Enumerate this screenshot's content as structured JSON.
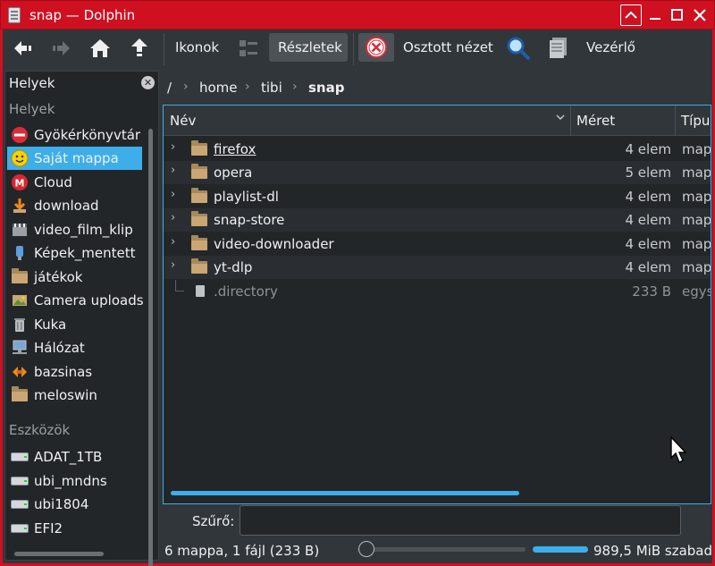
{
  "window": {
    "title": "snap — Dolphin",
    "controls": {
      "keep_above": "^",
      "minimize": "_",
      "maximize": "□",
      "close": "✕"
    }
  },
  "toolbar": {
    "back": "back-arrow-icon",
    "forward": "forward-arrow-icon",
    "home": "home-icon",
    "up": "up-arrow-icon",
    "icons_label": "Ikonok",
    "details_label": "Részletek",
    "split_label": "Osztott nézet",
    "control_label": "Vezérlő"
  },
  "places": {
    "header": "Helyek",
    "section_places": "Helyek",
    "items": [
      {
        "label": "Gyökérkönyvtár",
        "icon": "root-icon"
      },
      {
        "label": "Saját mappa",
        "icon": "home-smiley-icon",
        "selected": true
      },
      {
        "label": "Cloud",
        "icon": "mega-cloud-icon"
      },
      {
        "label": "download",
        "icon": "download-folder-icon"
      },
      {
        "label": "video_film_klip",
        "icon": "video-icon"
      },
      {
        "label": "Képek_mentett",
        "icon": "pictures-icon"
      },
      {
        "label": "játékok",
        "icon": "folder-icon"
      },
      {
        "label": "Camera uploads",
        "icon": "camera-folder-icon"
      },
      {
        "label": "Kuka",
        "icon": "trash-icon"
      },
      {
        "label": "Hálózat",
        "icon": "network-icon"
      },
      {
        "label": "bazsinas",
        "icon": "remote-icon"
      },
      {
        "label": "meloswin",
        "icon": "folder-icon"
      }
    ],
    "section_devices": "Eszközök",
    "devices": [
      {
        "label": "ADAT_1TB"
      },
      {
        "label": "ubi_mndns"
      },
      {
        "label": "ubi1804"
      },
      {
        "label": "EFI2"
      }
    ]
  },
  "breadcrumb": {
    "root": "/",
    "parts": [
      "home",
      "tibi",
      "snap"
    ]
  },
  "columns": {
    "name": "Név",
    "size": "Méret",
    "type": "Típu"
  },
  "files": [
    {
      "name": "firefox",
      "size": "4 elem",
      "type": "map"
    },
    {
      "name": "opera",
      "size": "5 elem",
      "type": "map"
    },
    {
      "name": "playlist-dl",
      "size": "4 elem",
      "type": "map"
    },
    {
      "name": "snap-store",
      "size": "4 elem",
      "type": "map"
    },
    {
      "name": "video-downloader",
      "size": "4 elem",
      "type": "map"
    },
    {
      "name": "yt-dlp",
      "size": "4 elem",
      "type": "map"
    },
    {
      "name": ".directory",
      "size": "233 B",
      "type": "egys"
    }
  ],
  "filter": {
    "label": "Szűrő:",
    "value": ""
  },
  "status": {
    "summary": "6 mappa, 1 fájl (233 B)",
    "free_space": "989,5 MiB szabad"
  },
  "colors": {
    "accent": "#3daee9",
    "titlebar": "#cf1020"
  }
}
